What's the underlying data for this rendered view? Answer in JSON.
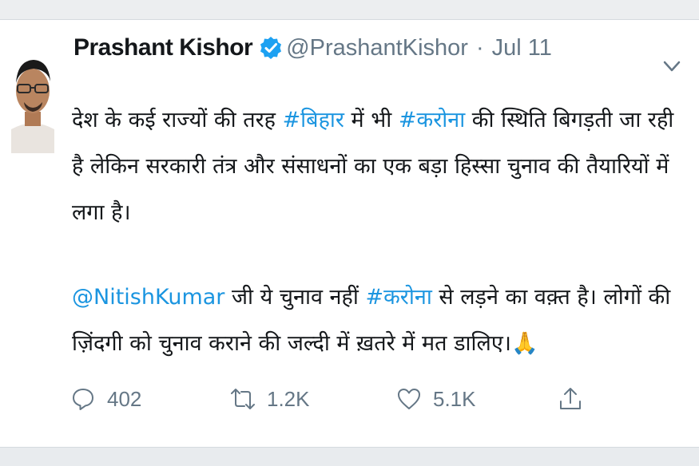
{
  "tweet": {
    "author": {
      "display_name": "Prashant Kishor",
      "handle": "@PrashantKishor",
      "verified": true
    },
    "separator": "·",
    "date": "Jul 11",
    "body": {
      "p1_part1": "देश के कई राज्यों की तरह ",
      "p1_hashtag1": "#बिहार",
      "p1_part2": " में भी ",
      "p1_hashtag2": "#करोना",
      "p1_part3": " की स्थिति बिगड़ती जा रही है लेकिन सरकारी तंत्र और संसाधनों का एक बड़ा हिस्सा चुनाव की तैयारियों में लगा है।",
      "p2_mention": "@NitishKumar",
      "p2_part1": " जी ये चुनाव नहीं ",
      "p2_hashtag": "#करोना",
      "p2_part2": " से लड़ने का वक़्त है। लोगों की ज़िंदगी को चुनाव कराने की जल्दी में ख़तरे में मत डालिए।",
      "p2_emoji": "🙏"
    },
    "actions": {
      "reply_count": "402",
      "retweet_count": "1.2K",
      "like_count": "5.1K"
    },
    "icons": [
      "verified-badge-icon",
      "chevron-down-icon",
      "reply-icon",
      "retweet-icon",
      "like-icon",
      "share-icon"
    ],
    "colors": {
      "link": "#1b95e0",
      "text": "#14171a",
      "muted": "#657786",
      "verified": "#1da1f2"
    }
  }
}
